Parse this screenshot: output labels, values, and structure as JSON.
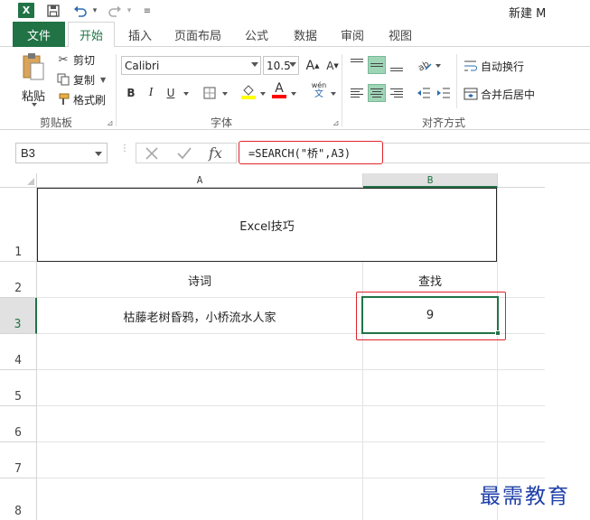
{
  "title_bar": {
    "app_icon_letter": "X",
    "document_title": "新建 M"
  },
  "tabs": [
    {
      "label": "文件"
    },
    {
      "label": "开始"
    },
    {
      "label": "插入"
    },
    {
      "label": "页面布局"
    },
    {
      "label": "公式"
    },
    {
      "label": "数据"
    },
    {
      "label": "审阅"
    },
    {
      "label": "视图"
    }
  ],
  "ribbon": {
    "clipboard": {
      "paste_label": "粘贴",
      "cut_label": "剪切",
      "copy_label": "复制",
      "format_painter_label": "格式刷",
      "group_label": "剪贴板"
    },
    "font": {
      "font_name": "Calibri",
      "font_size": "10.5",
      "group_label": "字体",
      "bold": "B",
      "italic": "I",
      "underline": "U",
      "grow": "A",
      "shrink": "A",
      "font_color_letter": "A",
      "phonetic_top": "wén",
      "phonetic_bottom": "文",
      "highlight_color": "#ffff00",
      "font_color": "#ff0000"
    },
    "alignment": {
      "wrap_text_label": "自动换行",
      "merge_center_label": "合并后居中",
      "group_label": "对齐方式"
    }
  },
  "formula_bar": {
    "name_box": "B3",
    "fx_label": "fx",
    "formula": "=SEARCH(\"桥\",A3)"
  },
  "sheet": {
    "columns": [
      "A",
      "B"
    ],
    "rows": [
      "1",
      "2",
      "3",
      "4",
      "5",
      "6",
      "7",
      "8"
    ],
    "selected_cell": "B3",
    "cells": {
      "A1": "Excel技巧",
      "A2": "诗词",
      "B2": "查找",
      "A3": "枯藤老树昏鸦，小桥流水人家",
      "B3": "9"
    },
    "accent_color": "#217346",
    "highlight_box_color": "#e0242b"
  },
  "watermark": "最需教育"
}
